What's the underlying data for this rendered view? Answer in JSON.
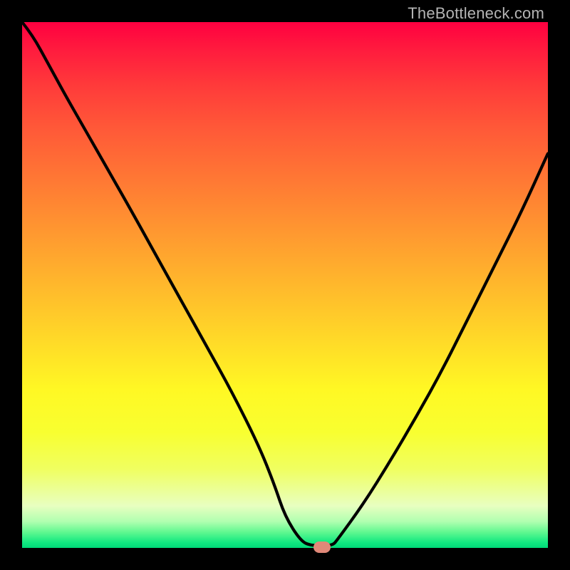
{
  "attribution": "TheBottleneck.com",
  "colors": {
    "curve": "#000000",
    "marker": "#e08878",
    "frame": "#000000"
  },
  "chart_data": {
    "type": "line",
    "title": "",
    "xlabel": "",
    "ylabel": "",
    "xlim": [
      0,
      100
    ],
    "ylim": [
      0,
      100
    ],
    "grid": false,
    "note": "Values estimated from pixel positions; axes not labeled in source image. y represents bottleneck percentage (high=red/top, low=green/bottom); x is an unlabeled configuration axis.",
    "series": [
      {
        "name": "bottleneck-curve",
        "x": [
          0,
          2,
          5,
          8,
          12,
          16,
          20,
          25,
          30,
          35,
          40,
          45,
          48,
          50,
          53,
          55,
          59,
          60,
          65,
          70,
          75,
          80,
          85,
          90,
          95,
          100
        ],
        "y": [
          100,
          97.5,
          92,
          86.5,
          79.5,
          72.5,
          65.5,
          56.5,
          47.5,
          38.5,
          29.5,
          19.5,
          12,
          6,
          1.3,
          0.4,
          0.4,
          1.6,
          8.5,
          16.5,
          25,
          34,
          44,
          54,
          64,
          75
        ]
      }
    ],
    "marker": {
      "x": 57,
      "y": 0.2
    }
  }
}
